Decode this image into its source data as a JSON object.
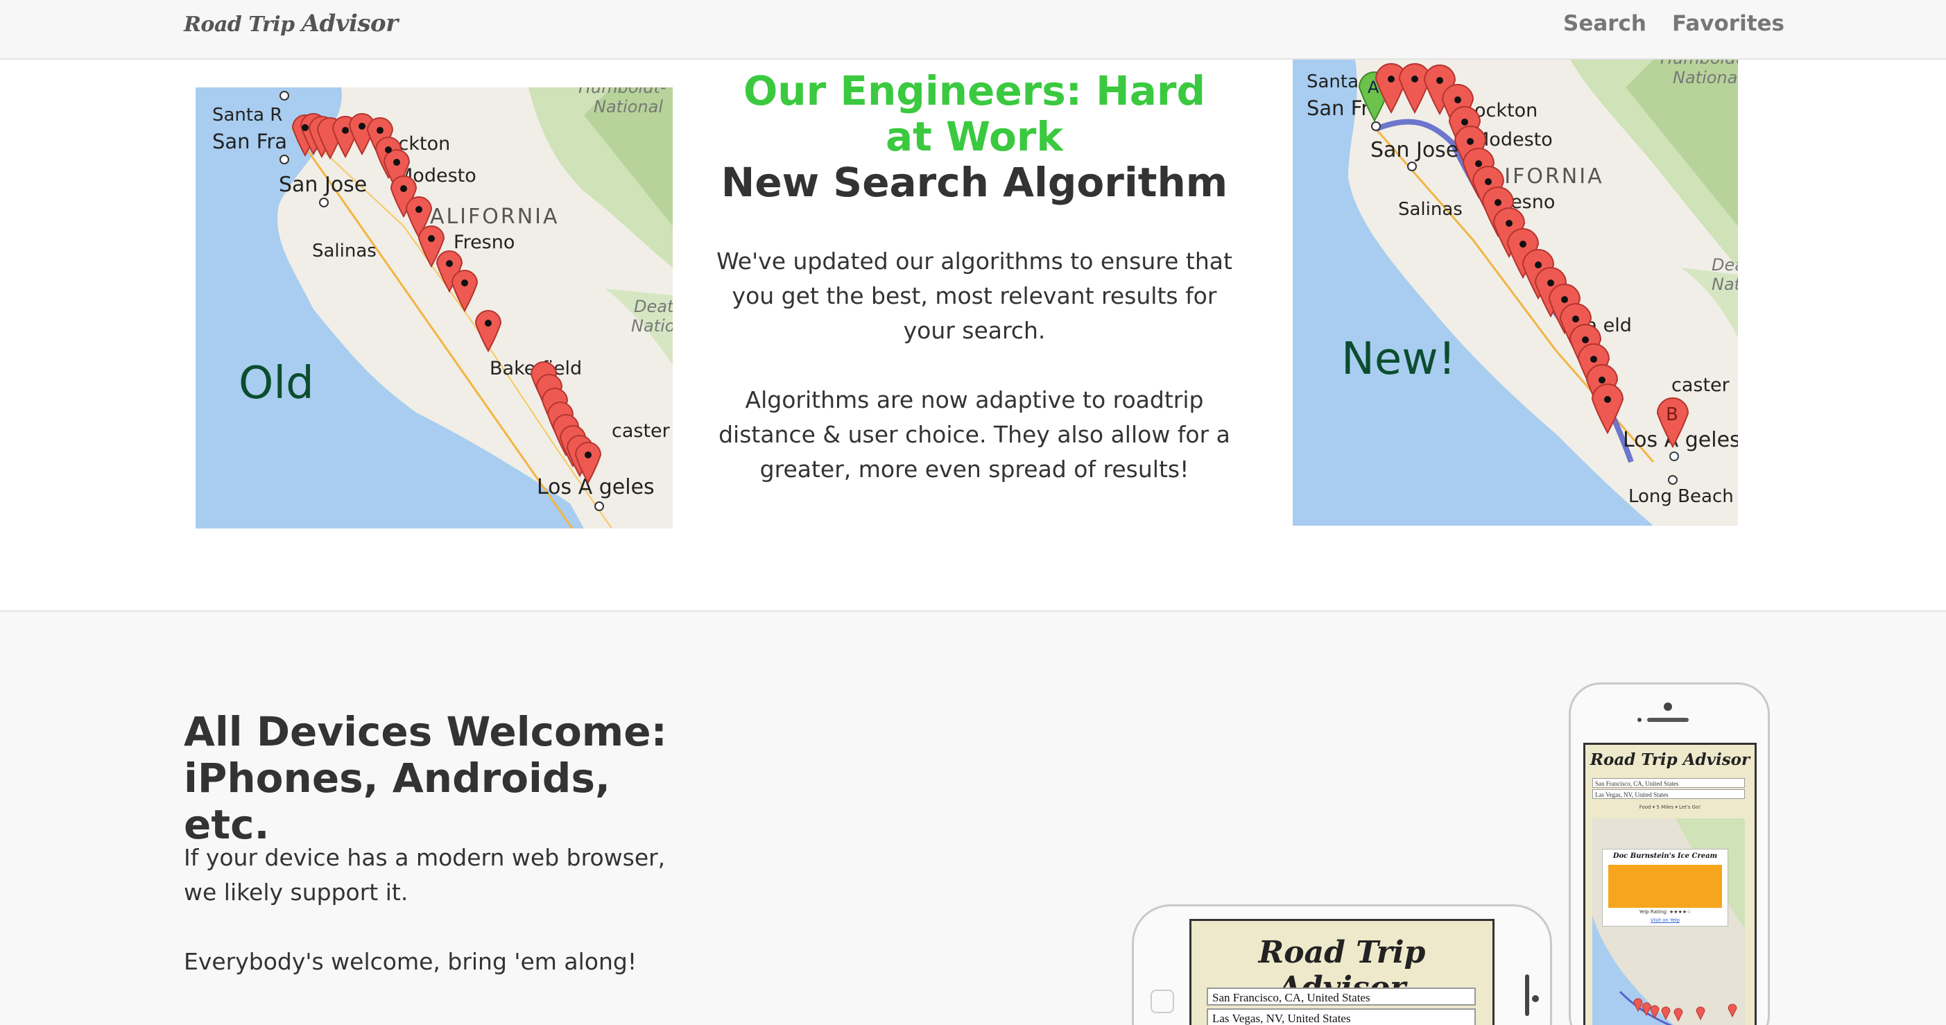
{
  "navbar": {
    "brand_part1": "Road Trip",
    "brand_part2": "Advisor",
    "links": {
      "search": "Search",
      "favorites": "Favorites"
    }
  },
  "algorithm_section": {
    "heading_green": "Our Engineers: Hard at Work",
    "heading_dark": "New Search Algorithm",
    "paragraph1": "We've updated our algorithms to ensure that you get the best, most relevant results for your search.",
    "paragraph2": "Algorithms are now adaptive to roadtrip distance & user choice. They also allow for a greater, more even spread of results!",
    "old_map": {
      "label": "Old",
      "places": {
        "santa_rosa": "Santa R",
        "san_francisco": "San Fra",
        "stockton": "ockton",
        "modesto": "Modesto",
        "san_jose": "San Jose",
        "california": "CALIFORNIA",
        "fresno": "Fresno",
        "salinas": "Salinas",
        "bakersfield": "Bake   field",
        "lancaster": "caster",
        "los_angeles": "Los A  geles",
        "humboldt": "Humboldt-",
        "national": "National",
        "death": "Deat",
        "natio": "Natio"
      }
    },
    "new_map": {
      "label": "New!",
      "places": {
        "santa": "Santa",
        "san_francisco": "San Fr",
        "stockton": "ockton",
        "modesto": "Modesto",
        "san_jose": "San Jose",
        "california": "ALIFORNIA",
        "fresno": "Fresno",
        "salinas": "Salinas",
        "bakersfield": "Ba     eld",
        "lancaster": "caster",
        "los_angeles": "Los A  geles",
        "long_beach": "Long Beach",
        "humboldt": "Humboldt",
        "national": "National",
        "death": "Dea",
        "nati": "Nati",
        "marker_a": "A",
        "marker_b": "B"
      }
    }
  },
  "devices_section": {
    "heading": "All Devices Welcome: iPhones, Androids, etc.",
    "paragraph1": "If your device has a modern web browser, we likely support it.",
    "paragraph2": "Everybody's welcome, bring 'em along!",
    "phone_landscape": {
      "app_title": "Road Trip Advisor",
      "origin": "San Francisco, CA, United States",
      "destination": "Las Vegas, NV, United States"
    },
    "phone_portrait": {
      "app_title": "Road Trip Advisor",
      "origin": "San Francisco, CA, United States",
      "destination": "Las Vegas, NV, United States",
      "controls": "Food  ▾   5 Miles  ▾   Let's Go!",
      "popup_title": "Doc Burnstein's Ice Cream",
      "popup_rating": "Yelp Rating: ★★★★☆",
      "popup_link": "Visit on Yelp"
    }
  }
}
